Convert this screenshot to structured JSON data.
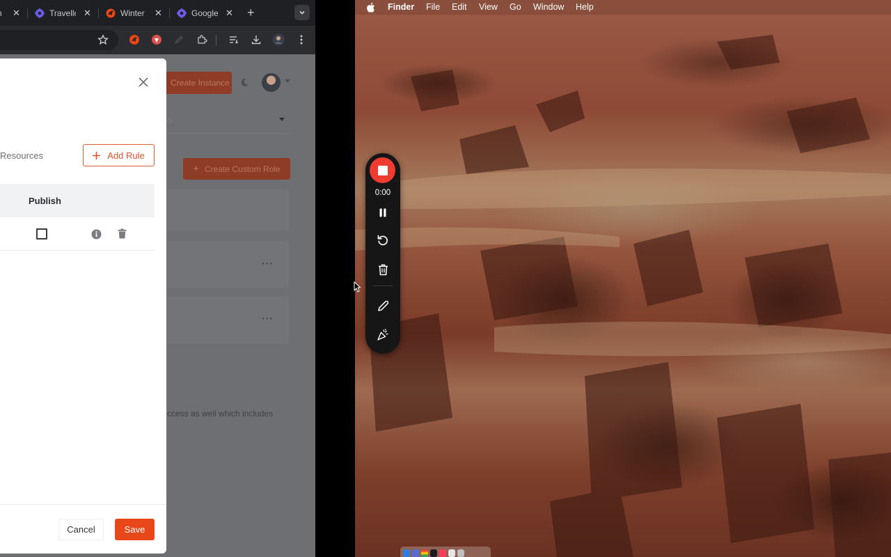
{
  "browser": {
    "tabs": [
      {
        "title": "Travello",
        "favicon": "purple-gear-icon"
      },
      {
        "title": "Winter",
        "favicon": "red-bird-icon"
      },
      {
        "title": "Google",
        "favicon": "purple-gear-icon"
      }
    ],
    "new_tab_label": "+",
    "tab_search_label": "⌄"
  },
  "page": {
    "create_instance_label": "Create Instance",
    "create_custom_role_label": "Create Custom Role",
    "select_value": "o",
    "access_text": "ccess as well which includes",
    "more_label": "···"
  },
  "modal": {
    "resources_placeholder": "Resources",
    "add_rule_label": "Add Rule",
    "table_header_publish": "Publish",
    "cancel_label": "Cancel",
    "save_label": "Save"
  },
  "menubar": {
    "items": [
      "Finder",
      "File",
      "Edit",
      "View",
      "Go",
      "Window",
      "Help"
    ]
  },
  "recorder": {
    "timer": "0:00"
  },
  "colors": {
    "accent": "#e8471a",
    "stop": "#ef3b30"
  }
}
